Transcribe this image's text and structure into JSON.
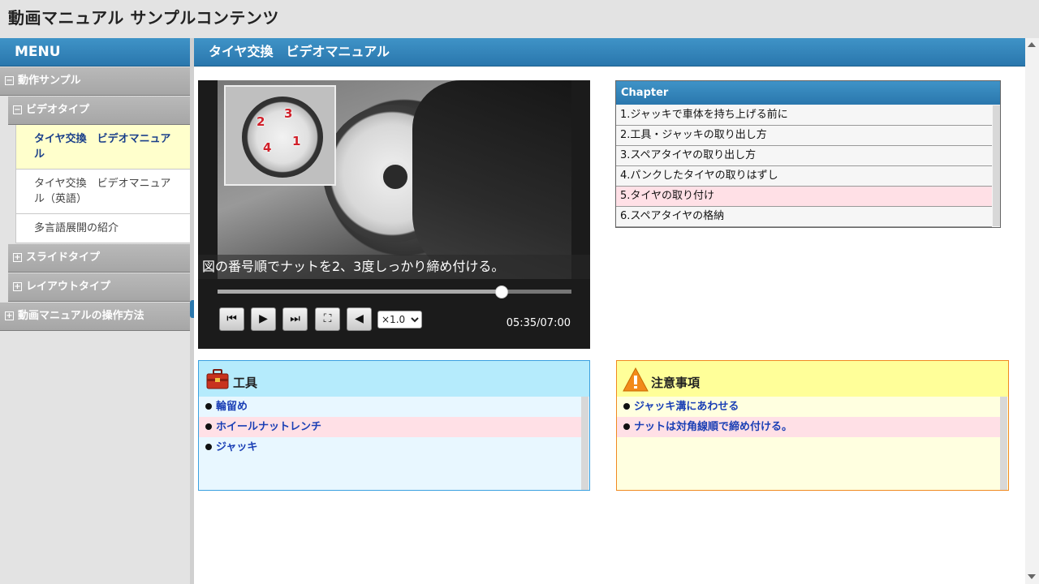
{
  "app": {
    "title": "動画マニュアル サンプルコンテンツ"
  },
  "sidebar": {
    "menu_label": "MENU",
    "group1": {
      "label": "動作サンプル",
      "toggle": "−",
      "sub": {
        "label": "ビデオタイプ",
        "toggle": "−",
        "items": [
          "タイヤ交換　ビデオマニュアル",
          "タイヤ交換　ビデオマニュアル（英語）",
          "多言語展開の紹介"
        ]
      },
      "sub2": {
        "label": "スライドタイプ",
        "toggle": "+"
      },
      "sub3": {
        "label": "レイアウトタイプ",
        "toggle": "+"
      }
    },
    "group2": {
      "label": "動画マニュアルの操作方法",
      "toggle": "+"
    }
  },
  "main": {
    "title": "タイヤ交換　ビデオマニュアル"
  },
  "player": {
    "caption": "図の番号順でナットを2、3度しっかり締め付ける。",
    "inset_numbers": [
      "2",
      "3",
      "4",
      "1"
    ],
    "progress": 0.8,
    "time": "05:35/07:00",
    "speed_options": [
      "×1.0"
    ],
    "controls": {
      "prev": "⏮",
      "play": "▶",
      "next": "⏭",
      "fullscreen": "⛶",
      "volume": "◀"
    }
  },
  "chapters": {
    "header": "Chapter",
    "items": [
      "1.ジャッキで車体を持ち上げる前に",
      "2.工具・ジャッキの取り出し方",
      "3.スペアタイヤの取り出し方",
      "4.パンクしたタイヤの取りはずし",
      "5.タイヤの取り付け",
      "6.スペアタイヤの格納"
    ],
    "active_index": 4
  },
  "tools": {
    "title": "工具",
    "items": [
      "輪留め",
      "ホイールナットレンチ",
      "ジャッキ"
    ]
  },
  "cautions": {
    "title": "注意事項",
    "items": [
      "ジャッキ溝にあわせる",
      "ナットは対角線順で締め付ける。"
    ]
  },
  "colors": {
    "header_blue": "#2a77ad",
    "active_chapter": "#ffe0e6",
    "tools_bg": "#e8f7ff",
    "caution_bg": "#ffffe0",
    "link_blue": "#1a3fb5"
  }
}
